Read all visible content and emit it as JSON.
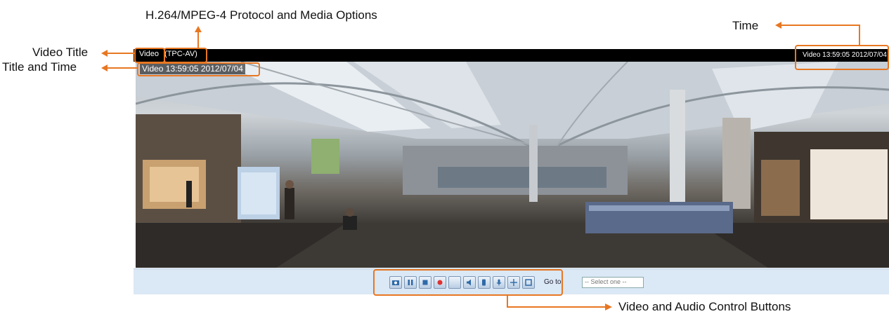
{
  "annotations": {
    "protocol_options": "H.264/MPEG-4 Protocol and Media Options",
    "time": "Time",
    "video_title": "Video Title",
    "title_and_time": "Title and Time",
    "control_buttons": "Video and Audio Control Buttons"
  },
  "titlebar": {
    "video_label": "Video",
    "stream_label": "(TPC-AV)",
    "time_stamp": "Video 13:59:05  2012/07/04"
  },
  "video": {
    "osd_title_time": "Video 13:59:05  2012/07/04"
  },
  "controls": {
    "buttons": [
      {
        "icon": "snapshot-icon"
      },
      {
        "icon": "pause-icon"
      },
      {
        "icon": "stop-icon"
      },
      {
        "icon": "record-icon"
      },
      {
        "icon": "blank-icon"
      },
      {
        "icon": "volume-icon"
      },
      {
        "icon": "talk-icon"
      },
      {
        "icon": "microphone-icon"
      },
      {
        "icon": "digital-zoom-icon"
      },
      {
        "icon": "fullscreen-icon"
      }
    ],
    "goto_label": "Go to",
    "goto_select_value": "-- Select one --"
  },
  "colors": {
    "annotation": "#e87722",
    "titlebar_bg": "#000000",
    "control_bar_bg": "#dbe8f5"
  }
}
